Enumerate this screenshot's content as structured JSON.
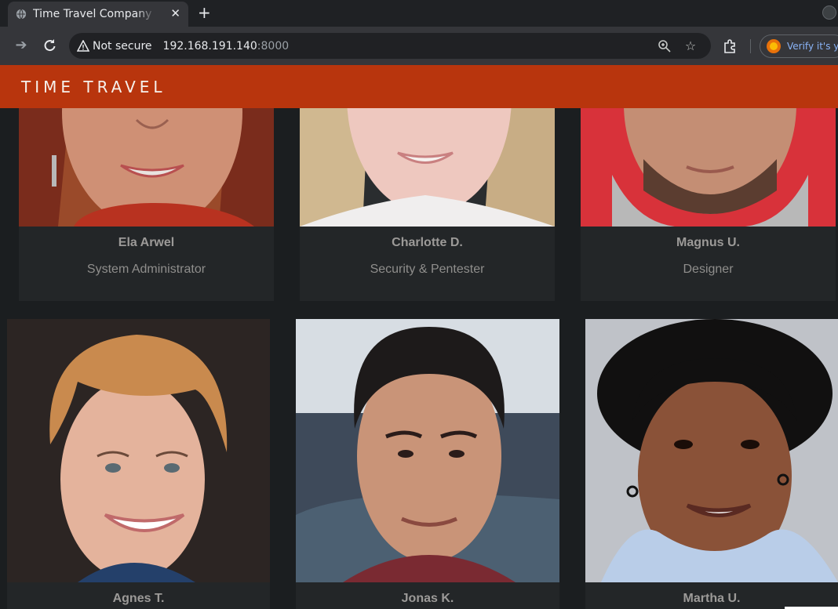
{
  "browser": {
    "tab_title": "Time Travel Company Page",
    "tab_close": "✕",
    "new_tab": "+",
    "security_label": "Not secure",
    "url_host": "192.168.191.140",
    "url_port": ":8000",
    "extension_chip_text": "Verify it's yo",
    "icons": [
      "globe-icon",
      "back-icon",
      "forward-icon",
      "reload-icon",
      "warning-icon",
      "zoom-icon",
      "star-icon",
      "extensions-icon"
    ]
  },
  "site": {
    "brand": "TIME TRAVEL",
    "header_color": "#b8350d"
  },
  "team": [
    {
      "name": "Ela Arwel",
      "role": "System Administrator"
    },
    {
      "name": "Charlotte D.",
      "role": "Security & Pentester"
    },
    {
      "name": "Magnus U.",
      "role": "Designer"
    },
    {
      "name": "Agnes T.",
      "role": ""
    },
    {
      "name": "Jonas K.",
      "role": ""
    },
    {
      "name": "Martha U.",
      "role": ""
    }
  ]
}
